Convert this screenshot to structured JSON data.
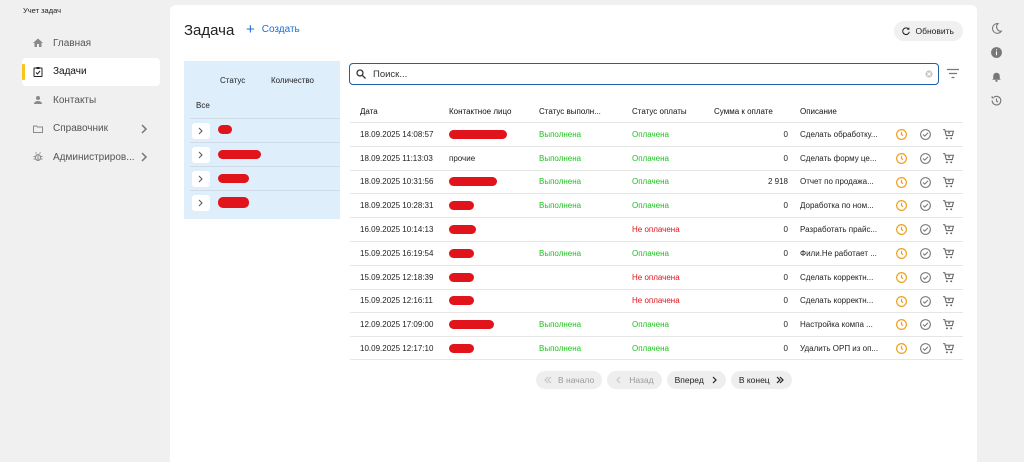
{
  "app": {
    "title": "Учет задач"
  },
  "sidebar": {
    "items": [
      {
        "label": "Главная",
        "icon": "home-icon",
        "active": false
      },
      {
        "label": "Задачи",
        "icon": "task-check-icon",
        "active": true
      },
      {
        "label": "Контакты",
        "icon": "person-icon",
        "active": false
      },
      {
        "label": "Справочник",
        "icon": "folder-icon",
        "active": false
      },
      {
        "label": "Администриров...",
        "icon": "bug-icon",
        "active": false
      }
    ]
  },
  "header": {
    "title": "Задача",
    "create_label": "Создать",
    "refresh_label": "Обновить"
  },
  "status_panel": {
    "col_status": "Статус",
    "col_count": "Количество",
    "all_label": "Все"
  },
  "search": {
    "placeholder": "Поиск..."
  },
  "table": {
    "headers": [
      "Дата",
      "Контактное лицо",
      "Статус выполн...",
      "Статус оплаты",
      "Сумма к оплате",
      "Описание"
    ],
    "rows": [
      {
        "date": "18.09.2025 14:08:57",
        "contact": "",
        "exec": "Выполнена",
        "pay": "Оплачена",
        "pay_status": "paid",
        "sum": "0",
        "desc": "Сделать обработку..."
      },
      {
        "date": "18.09.2025 11:13:03",
        "contact": "прочие",
        "exec": "Выполнена",
        "pay": "Оплачена",
        "pay_status": "paid",
        "sum": "0",
        "desc": "Сделать форму це..."
      },
      {
        "date": "18.09.2025 10:31:56",
        "contact": "",
        "exec": "Выполнена",
        "pay": "Оплачена",
        "pay_status": "paid",
        "sum": "2 918",
        "desc": "Отчет по продажа..."
      },
      {
        "date": "18.09.2025 10:28:31",
        "contact": "",
        "exec": "Выполнена",
        "pay": "Оплачена",
        "pay_status": "paid",
        "sum": "0",
        "desc": "Доработка по ном..."
      },
      {
        "date": "16.09.2025 10:14:13",
        "contact": "",
        "exec": "",
        "pay": "Не оплачена",
        "pay_status": "unpaid",
        "sum": "0",
        "desc": "Разработать прайс..."
      },
      {
        "date": "15.09.2025 16:19:54",
        "contact": "",
        "exec": "Выполнена",
        "pay": "Оплачена",
        "pay_status": "paid",
        "sum": "0",
        "desc": "Фили.Не работает ..."
      },
      {
        "date": "15.09.2025 12:18:39",
        "contact": "",
        "exec": "",
        "pay": "Не оплачена",
        "pay_status": "unpaid",
        "sum": "0",
        "desc": "Сделать корректн..."
      },
      {
        "date": "15.09.2025 12:16:11",
        "contact": "",
        "exec": "",
        "pay": "Не оплачена",
        "pay_status": "unpaid",
        "sum": "0",
        "desc": "Сделать корректн..."
      },
      {
        "date": "12.09.2025 17:09:00",
        "contact": "",
        "exec": "Выполнена",
        "pay": "Оплачена",
        "pay_status": "paid",
        "sum": "0",
        "desc": "Настройка компа ..."
      },
      {
        "date": "10.09.2025 12:17:10",
        "contact": "",
        "exec": "Выполнена",
        "pay": "Оплачена",
        "pay_status": "paid",
        "sum": "0",
        "desc": "Удалить ОРП из оп..."
      }
    ]
  },
  "pager": {
    "first": "В начало",
    "prev": "Назад",
    "next": "Вперед",
    "last": "В конец"
  },
  "colors": {
    "accent": "#1a6fd6",
    "active_marker": "#f5c518",
    "paid": "#1cc21c",
    "unpaid": "#e0141a",
    "panel_bg": "#dfeefb",
    "redaction": "#e0141a",
    "clock_icon": "#f0a020"
  }
}
